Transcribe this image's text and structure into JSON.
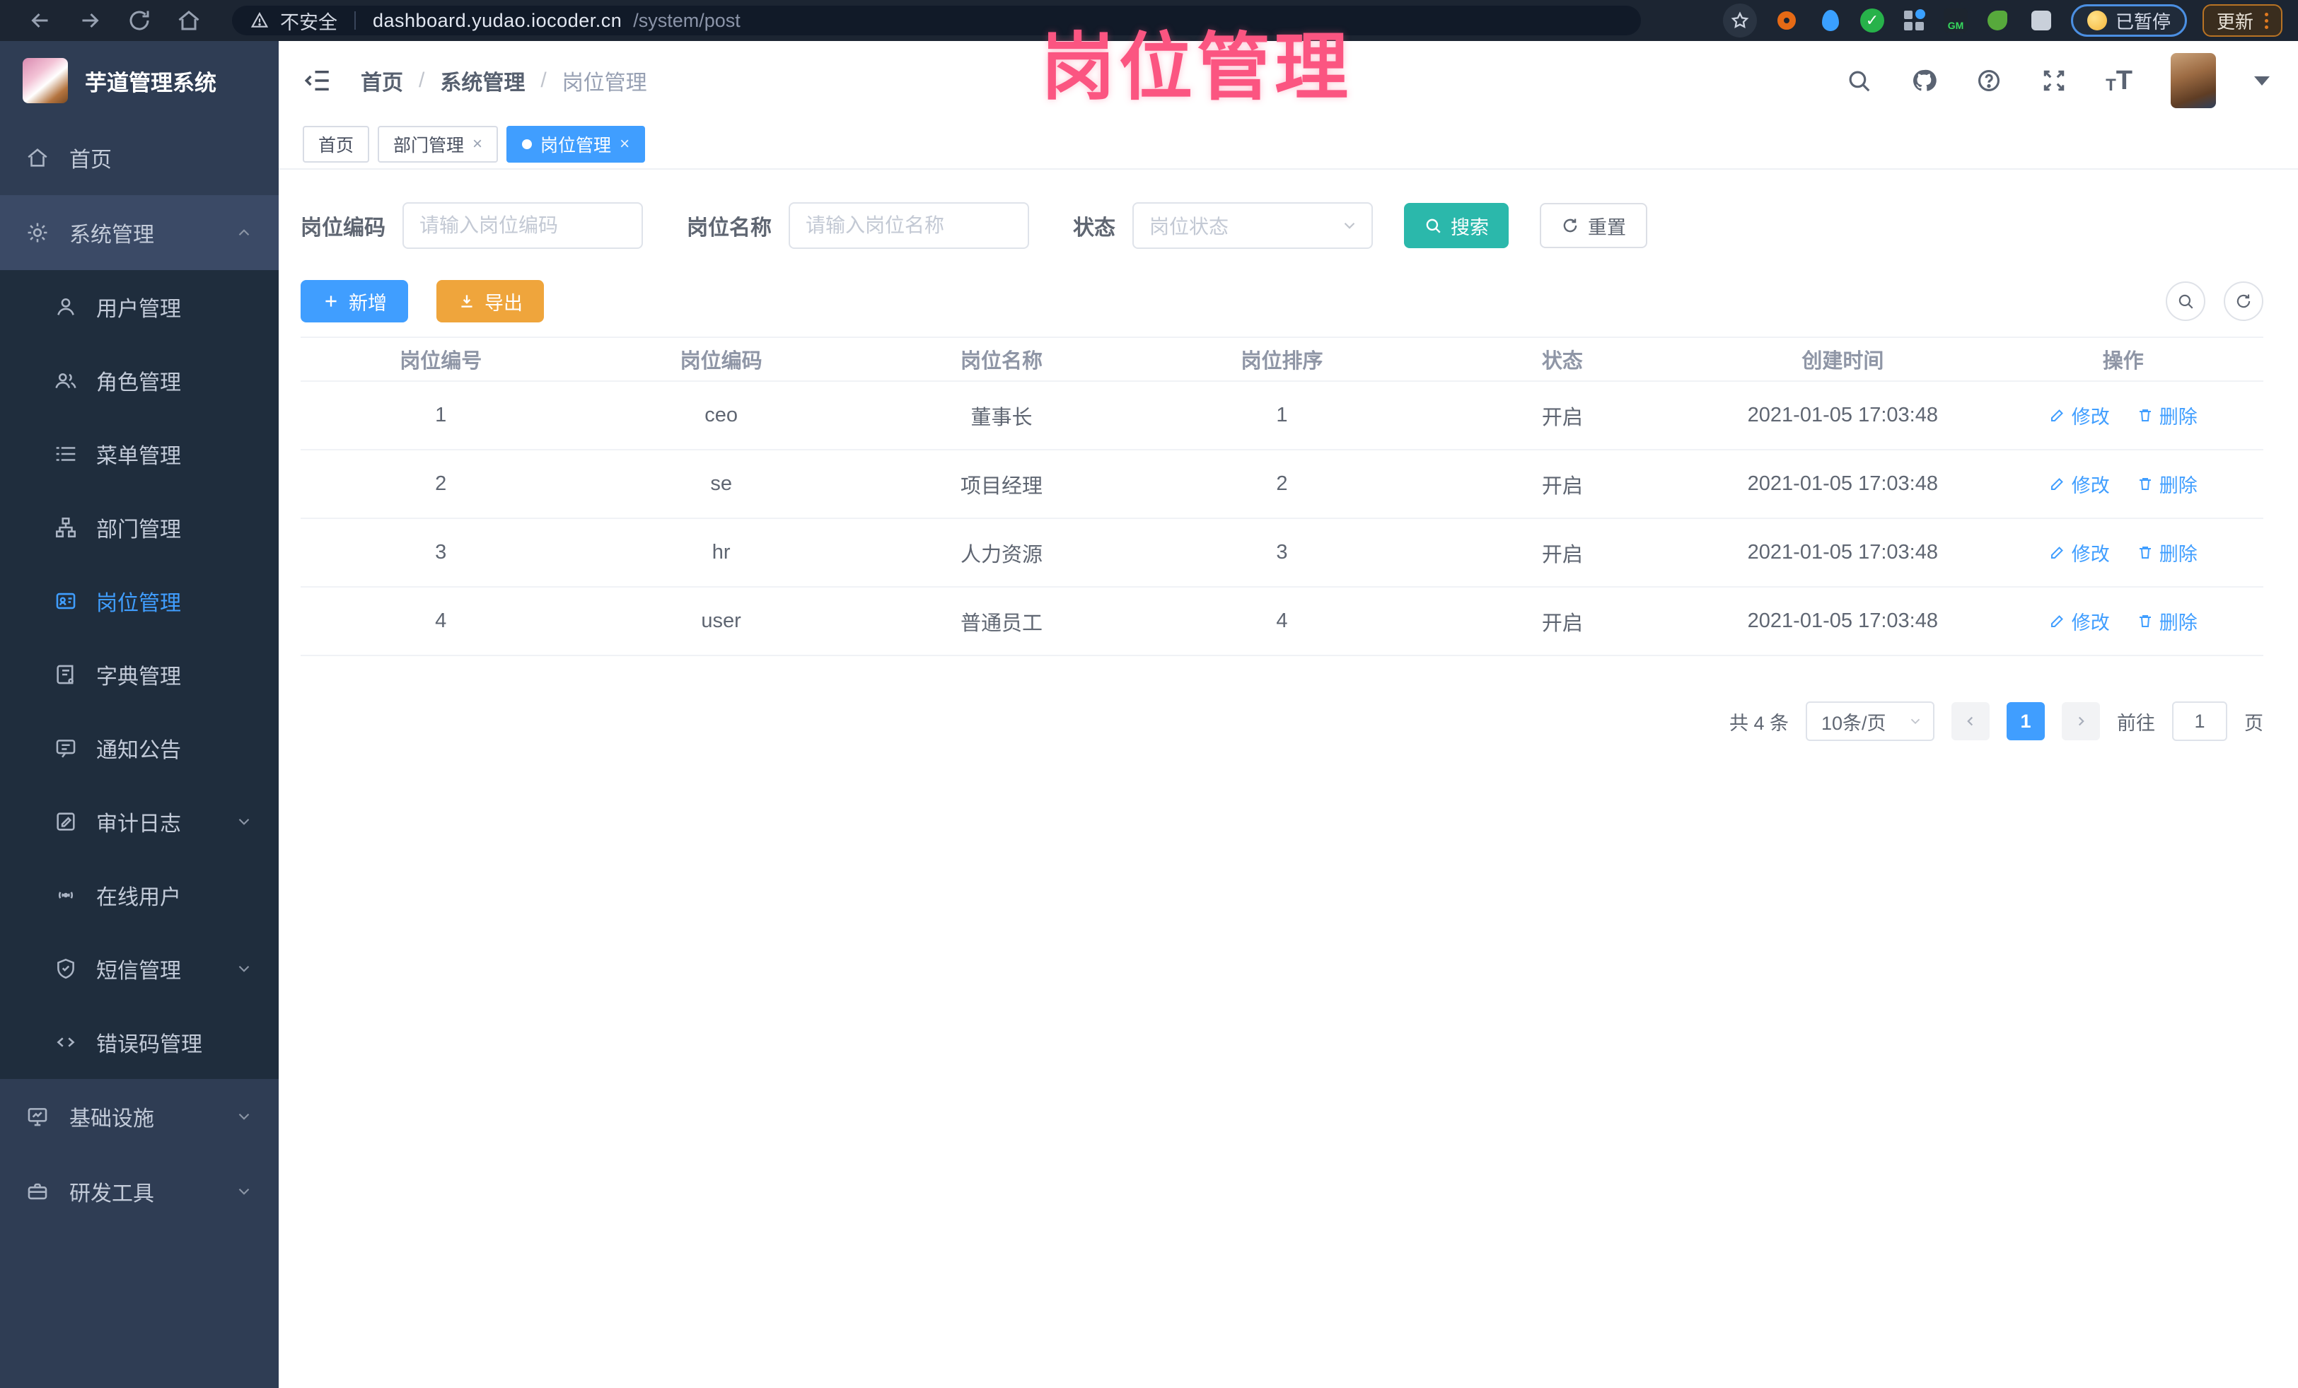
{
  "watermark": "岗位管理",
  "browser": {
    "security_label": "不安全",
    "url_host": "dashboard.yudao.iocoder.cn",
    "url_path": "/system/post",
    "paused_badge": "已暂停",
    "update_button": "更新",
    "gm_badge": "GM",
    "nav_icons": [
      "back-arrow",
      "forward-arrow",
      "reload",
      "home"
    ],
    "extension_icons": [
      "bookmark-star",
      "orange-donut-extension",
      "blue-pin-extension",
      "green-check-extension",
      "grid-extension",
      "gm-extension",
      "green-leaf-extension",
      "gray-extension"
    ]
  },
  "sidebar": {
    "title": "芋道管理系统",
    "items": [
      {
        "label": "首页",
        "icon": "home-icon",
        "level": "top"
      },
      {
        "label": "系统管理",
        "icon": "gear-icon",
        "level": "top",
        "expanded": true
      },
      {
        "label": "用户管理",
        "icon": "user-icon",
        "level": "sub"
      },
      {
        "label": "角色管理",
        "icon": "users-icon",
        "level": "sub"
      },
      {
        "label": "菜单管理",
        "icon": "list-icon",
        "level": "sub"
      },
      {
        "label": "部门管理",
        "icon": "org-tree-icon",
        "level": "sub"
      },
      {
        "label": "岗位管理",
        "icon": "id-card-icon",
        "level": "sub",
        "active": true
      },
      {
        "label": "字典管理",
        "icon": "book-icon",
        "level": "sub"
      },
      {
        "label": "通知公告",
        "icon": "message-icon",
        "level": "sub"
      },
      {
        "label": "审计日志",
        "icon": "edit-log-icon",
        "level": "sub",
        "collapsed": true
      },
      {
        "label": "在线用户",
        "icon": "online-signal-icon",
        "level": "sub"
      },
      {
        "label": "短信管理",
        "icon": "shield-icon",
        "level": "sub",
        "collapsed": true
      },
      {
        "label": "错误码管理",
        "icon": "code-icon",
        "level": "sub"
      },
      {
        "label": "基础设施",
        "icon": "monitor-icon",
        "level": "top",
        "collapsed": true
      },
      {
        "label": "研发工具",
        "icon": "briefcase-icon",
        "level": "top",
        "collapsed": true
      }
    ]
  },
  "header": {
    "breadcrumb": [
      "首页",
      "系统管理",
      "岗位管理"
    ],
    "separator": "/",
    "right_icons": [
      "search-icon",
      "github-icon",
      "help-icon",
      "fullscreen-icon",
      "font-size-icon",
      "avatar",
      "caret-down-icon"
    ]
  },
  "tabs": [
    {
      "label": "首页",
      "active": false,
      "closable": false
    },
    {
      "label": "部门管理",
      "active": false,
      "closable": true
    },
    {
      "label": "岗位管理",
      "active": true,
      "closable": true
    }
  ],
  "tab_close_glyph": "×",
  "filters": {
    "code_label": "岗位编码",
    "code_placeholder": "请输入岗位编码",
    "name_label": "岗位名称",
    "name_placeholder": "请输入岗位名称",
    "status_label": "状态",
    "status_placeholder": "岗位状态",
    "search_label": "搜索",
    "reset_label": "重置"
  },
  "toolbar": {
    "add_label": "新增",
    "export_label": "导出",
    "icon_buttons": [
      "search-toggle-icon",
      "refresh-icon"
    ]
  },
  "table": {
    "columns": [
      "岗位编号",
      "岗位编码",
      "岗位名称",
      "岗位排序",
      "状态",
      "创建时间",
      "操作"
    ],
    "edit_label": "修改",
    "delete_label": "删除",
    "rows": [
      {
        "id": "1",
        "code": "ceo",
        "name": "董事长",
        "sort": "1",
        "status": "开启",
        "created": "2021-01-05 17:03:48"
      },
      {
        "id": "2",
        "code": "se",
        "name": "项目经理",
        "sort": "2",
        "status": "开启",
        "created": "2021-01-05 17:03:48"
      },
      {
        "id": "3",
        "code": "hr",
        "name": "人力资源",
        "sort": "3",
        "status": "开启",
        "created": "2021-01-05 17:03:48"
      },
      {
        "id": "4",
        "code": "user",
        "name": "普通员工",
        "sort": "4",
        "status": "开启",
        "created": "2021-01-05 17:03:48"
      }
    ]
  },
  "pagination": {
    "total_text": "共 4 条",
    "page_size": "10条/页",
    "current_page": "1",
    "goto_label": "前往",
    "goto_value": "1",
    "page_unit": "页"
  },
  "colors": {
    "accent_blue": "#409eff",
    "teal_search": "#2bb8ab",
    "warning_orange": "#efa53c",
    "sidebar_bg": "#2f3d54",
    "submenu_bg": "#1f2d3d",
    "watermark_pink": "#fb5581",
    "browser_bar_bg": "#1c2532"
  }
}
